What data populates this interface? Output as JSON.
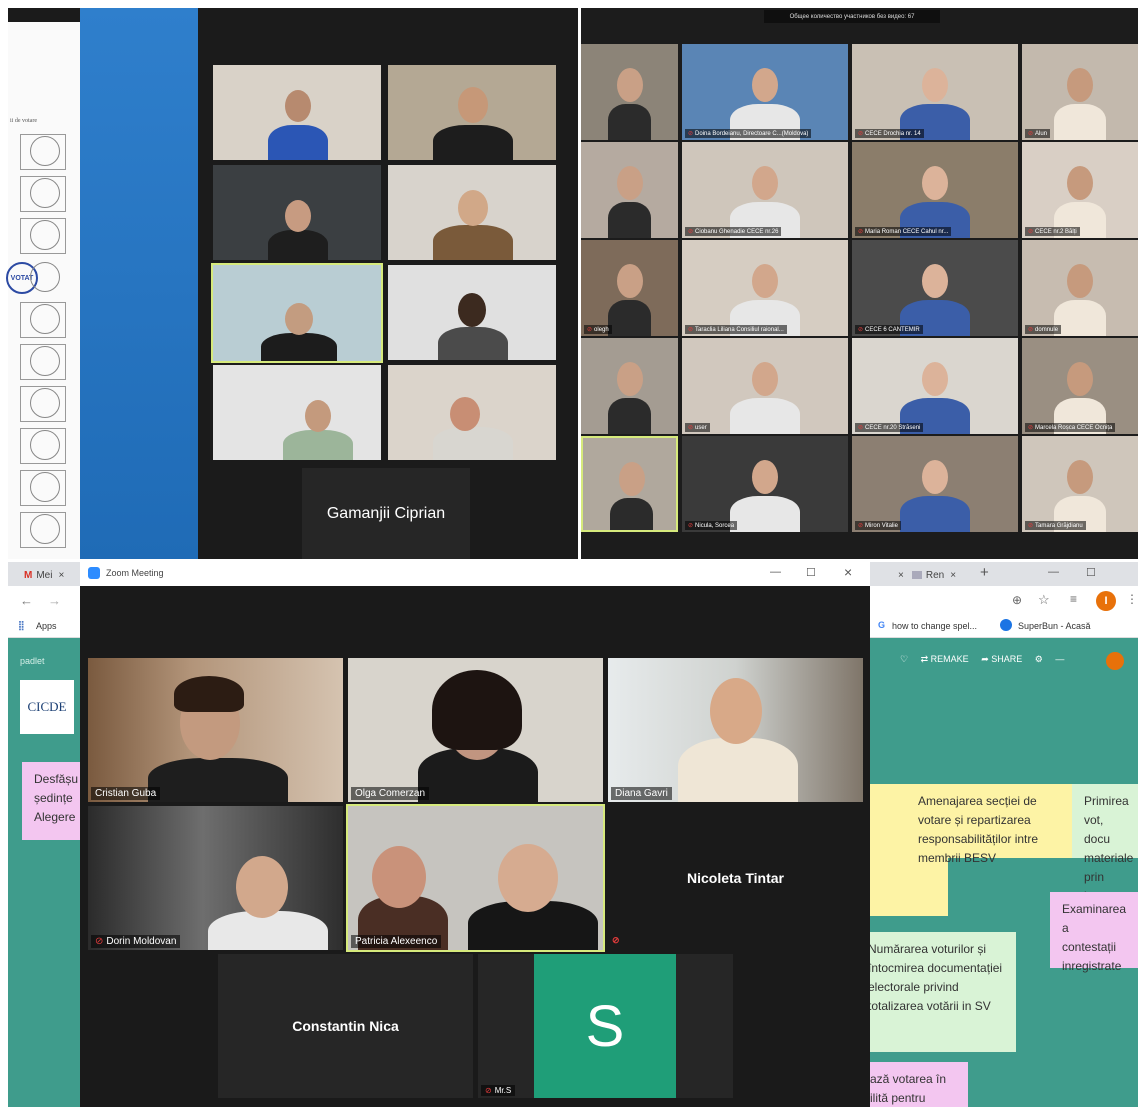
{
  "panel_a": {
    "doc_fragment": "ii de votare",
    "stamp_text": "VOTAT",
    "speaker_name": "Gamanjii Ciprian"
  },
  "panel_b": {
    "top_banner": "Общее количество участников без видео: 67",
    "tiles": [
      {
        "label": ""
      },
      {
        "label": "Doina Bordeianu, Directoare C...(Moldova)"
      },
      {
        "label": "CECE Drochia nr. 14"
      },
      {
        "label": "Alun"
      },
      {
        "label": ""
      },
      {
        "label": "Ciobanu Ghenadie CECE nr.26"
      },
      {
        "label": "Maria Roman CECE Cahul nr..."
      },
      {
        "label": "CECE nr.2 Bălți"
      },
      {
        "label": "olegh"
      },
      {
        "label": "Taraclia Liliana Consiliul raional..."
      },
      {
        "label": "CECE 6 CANTEMIR"
      },
      {
        "label": "domnule"
      },
      {
        "label": ""
      },
      {
        "label": "user"
      },
      {
        "label": "CECE nr.20 Străseni"
      },
      {
        "label": "Marcela Roșca CECE Ocnița"
      },
      {
        "label": ""
      },
      {
        "label": "Nicula, Sorcea"
      },
      {
        "label": "Miron Vitalie"
      },
      {
        "label": "Tamara Grăjdianu"
      }
    ]
  },
  "panel_c": {
    "browser": {
      "tab1": "Mei",
      "tab2": "Zoom Meeting",
      "tab3": "Ren",
      "new_tab": "+",
      "back": "←",
      "forward": "→",
      "apps_label": "Apps",
      "bookmark1": "how to change spel...",
      "bookmark2": "SuperBun - Acasă",
      "avatar_letter": "I"
    },
    "zoom": {
      "title": "Zoom Meeting",
      "minimize": "—",
      "maximize": "☐",
      "close": "×",
      "participants": [
        {
          "name": "Cristian Guba"
        },
        {
          "name": "Olga Comerzan"
        },
        {
          "name": "Diana Gavri"
        },
        {
          "name": "Dorin Moldovan"
        },
        {
          "name": "Patricia Alexeenco"
        },
        {
          "name": "Mr.S"
        }
      ],
      "name_tiles": {
        "nicoleta": "Nicoleta Tintar",
        "constantin": "Constantin Nica",
        "avatar_letter": "S"
      }
    },
    "padlet": {
      "owner": "padlet",
      "logo": "CICDE",
      "remake": "REMAKE",
      "share": "SHARE",
      "left_note": "Desfășu ședințe Alegere",
      "notes": [
        "Amenajarea secției de votare și repartizarea responsabilităților intre membrii BESV",
        "Primirea vot, docu materiale prin inter",
        "Examinarea a contestații inregistrate",
        "Numărarea voturilor și întocmirea documentației electorale privind totalizarea votării in SV",
        "ază votarea în ilită pentru"
      ]
    }
  }
}
